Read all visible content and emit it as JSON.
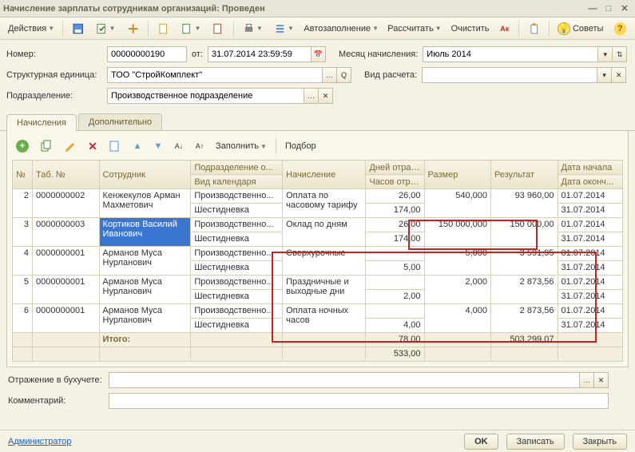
{
  "title": "Начисление зарплаты сотрудникам организаций: Проведен",
  "toolbar": {
    "actions": "Действия",
    "autofill": "Автозаполнение",
    "calc": "Рассчитать",
    "clear": "Очистить",
    "tips": "Советы"
  },
  "form": {
    "number_lbl": "Номер:",
    "number": "00000000190",
    "from_lbl": "от:",
    "from": "31.07.2014 23:59:59",
    "month_lbl": "Месяц начисления:",
    "month": "Июль 2014",
    "org_lbl": "Структурная единица:",
    "org": "ТОО \"СтройКомплект\"",
    "calc_type_lbl": "Вид расчета:",
    "calc_type": "",
    "dept_lbl": "Подразделение:",
    "dept": "Производственное подразделение"
  },
  "tabs": {
    "t1": "Начисления",
    "t2": "Дополнительно"
  },
  "gridbar": {
    "fill": "Заполнить",
    "select": "Подбор"
  },
  "cols": {
    "n": "№",
    "tab": "Таб. №",
    "emp": "Сотрудник",
    "dept": "Подразделение о...",
    "cal": "Вид календаря",
    "acc": "Начисление",
    "days": "Дней отраб...",
    "hours": "Часов отра...",
    "size": "Размер",
    "result": "Результат",
    "dstart": "Дата начала",
    "dend": "Дата оконч..."
  },
  "rows": [
    {
      "n": "2",
      "tab": "0000000002",
      "emp": "Кенжекулов Арман Махметович",
      "dept": "Производственно...",
      "cal": "Шестидневка",
      "acc": "Оплата по часовому тарифу",
      "days": "26,00",
      "hours": "174,00",
      "size": "540,000",
      "result": "93 960,00",
      "d1": "01.07.2014",
      "d2": "31.07.2014"
    },
    {
      "n": "3",
      "tab": "0000000003",
      "emp": "Кортиков Василий Иванович",
      "dept": "Производственно...",
      "cal": "Шестидневка",
      "acc": "Оклад по дням",
      "days": "26,00",
      "hours": "174,00",
      "size": "150 000,000",
      "result": "150 000,00",
      "d1": "01.07.2014",
      "d2": "31.07.2014",
      "sel": true
    },
    {
      "n": "4",
      "tab": "0000000001",
      "emp": "Арманов Муса Нурланович",
      "dept": "Производственно...",
      "cal": "Шестидневка",
      "acc": "Сверхурочные",
      "days": "",
      "hours": "5,00",
      "size": "5,000",
      "result": "3 591,95",
      "d1": "01.07.2014",
      "d2": "31.07.2014"
    },
    {
      "n": "5",
      "tab": "0000000001",
      "emp": "Арманов Муса Нурланович",
      "dept": "Производственно...",
      "cal": "Шестидневка",
      "acc": "Праздничные и выходные дни",
      "days": "",
      "hours": "2,00",
      "size": "2,000",
      "result": "2 873,56",
      "d1": "01.07.2014",
      "d2": "31.07.2014"
    },
    {
      "n": "6",
      "tab": "0000000001",
      "emp": "Арманов Муса Нурланович",
      "dept": "Производственно...",
      "cal": "Шестидневка",
      "acc": "Оплата ночных часов",
      "days": "",
      "hours": "4,00",
      "size": "4,000",
      "result": "2 873,56",
      "d1": "01.07.2014",
      "d2": "31.07.2014"
    }
  ],
  "totals": {
    "label": "Итого:",
    "days": "78,00",
    "hours": "533,00",
    "result": "503 299,07"
  },
  "footer": {
    "acct_lbl": "Отражение в бухучете:",
    "comment_lbl": "Комментарий:",
    "admin": "Администратор",
    "ok": "OK",
    "save": "Записать",
    "close": "Закрыть"
  }
}
